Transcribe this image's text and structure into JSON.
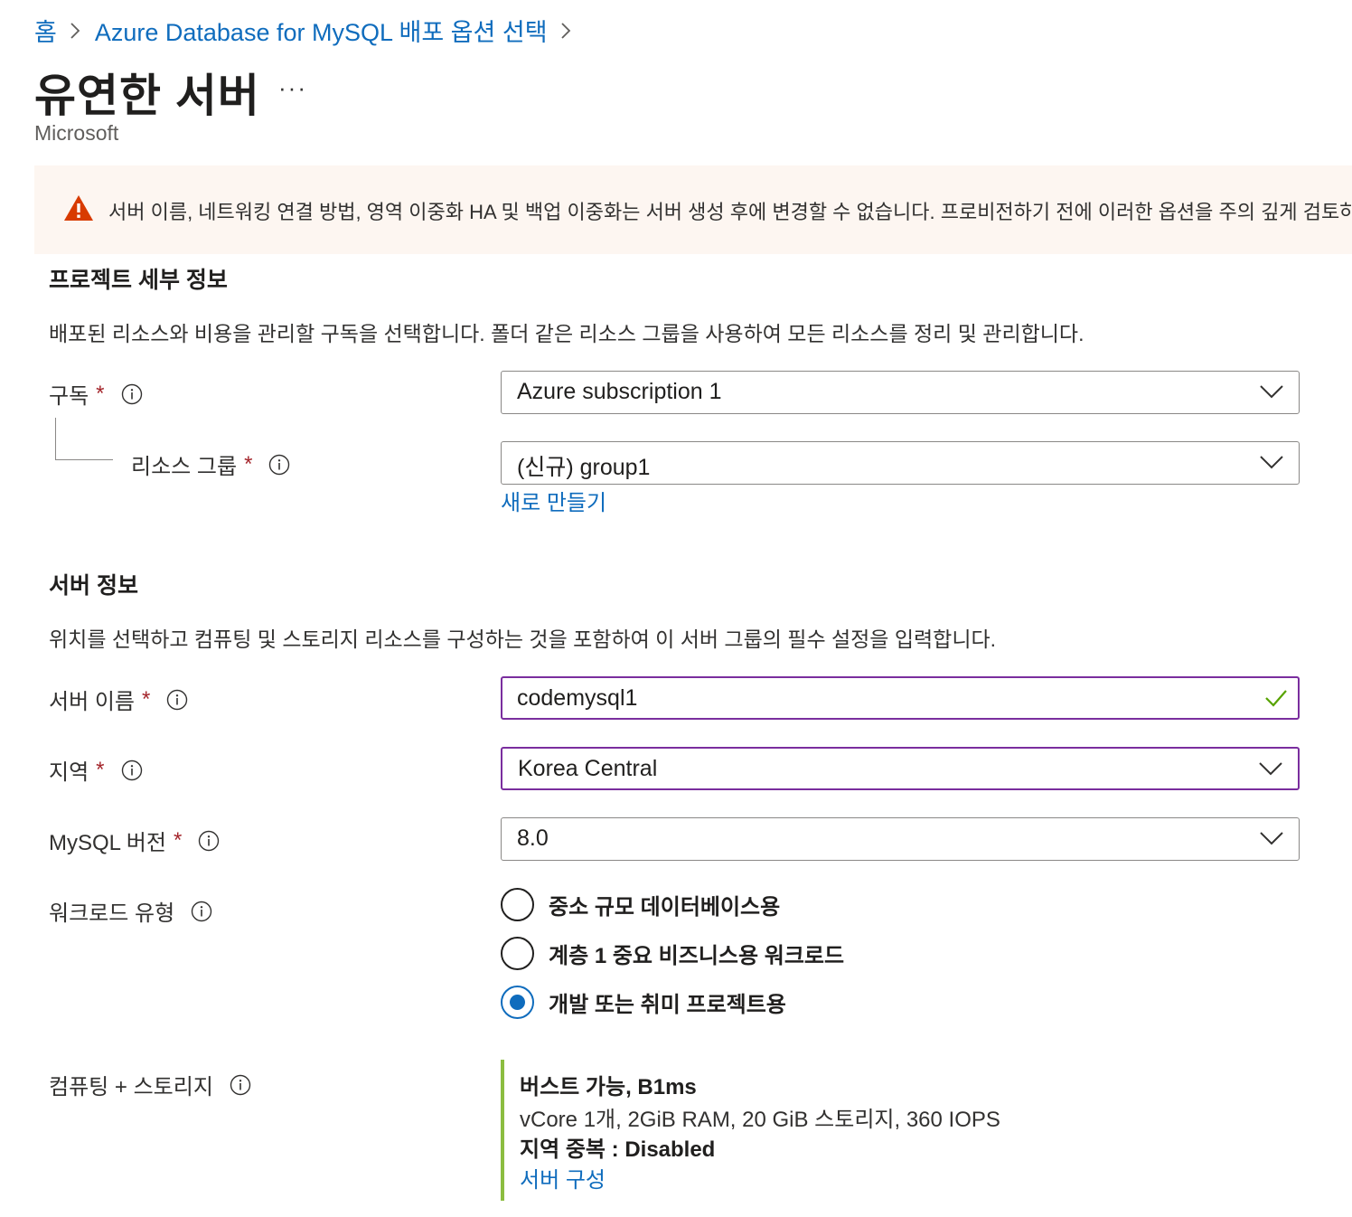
{
  "breadcrumb": {
    "items": [
      "홈",
      "Azure Database for MySQL 배포 옵션 선택"
    ]
  },
  "header": {
    "title": "유연한 서버",
    "more": "···",
    "publisher": "Microsoft"
  },
  "warning": {
    "text": "서버 이름, 네트워킹 연결 방법, 영역 이중화 HA 및 백업 이중화는 서버 생성 후에 변경할 수 없습니다. 프로비전하기 전에 이러한 옵션을 주의 깊게 검토하세요."
  },
  "project": {
    "title": "프로젝트 세부 정보",
    "description": "배포된 리소스와 비용을 관리할 구독을 선택합니다. 폴더 같은 리소스 그룹을 사용하여 모든 리소스를 정리 및 관리합니다.",
    "subscription": {
      "label": "구독",
      "required": "*",
      "value": "Azure subscription 1"
    },
    "resource_group": {
      "label": "리소스 그룹",
      "required": "*",
      "value": "(신규) group1",
      "create_new": "새로 만들기"
    }
  },
  "server": {
    "title": "서버 정보",
    "description": "위치를 선택하고 컴퓨팅 및 스토리지 리소스를 구성하는 것을 포함하여 이 서버 그룹의 필수 설정을 입력합니다.",
    "name": {
      "label": "서버 이름",
      "required": "*",
      "value": "codemysql1"
    },
    "region": {
      "label": "지역",
      "required": "*",
      "value": "Korea Central"
    },
    "version": {
      "label": "MySQL 버전",
      "required": "*",
      "value": "8.0"
    },
    "workload": {
      "label": "워크로드 유형",
      "options": [
        {
          "label": "중소 규모 데이터베이스용",
          "checked": false
        },
        {
          "label": "계층 1 중요 비즈니스용 워크로드",
          "checked": false
        },
        {
          "label": "개발 또는 취미 프로젝트용",
          "checked": true
        }
      ]
    },
    "compute": {
      "label": "컴퓨팅 + 스토리지",
      "tier": "버스트 가능, B1ms",
      "spec": "vCore 1개, 2GiB RAM, 20 GiB 스토리지, 360 IOPS",
      "geo_redundancy": "지역 중복 : Disabled",
      "configure_link": "서버 구성"
    }
  },
  "colors": {
    "link": "#0f6cbd",
    "required": "#a4262c",
    "focus_border": "#7a2e9e",
    "warning_bg": "#fdf6f1",
    "warning_icon": "#d83b01",
    "success_check": "#57a300",
    "summary_accent": "#8cbd40"
  }
}
